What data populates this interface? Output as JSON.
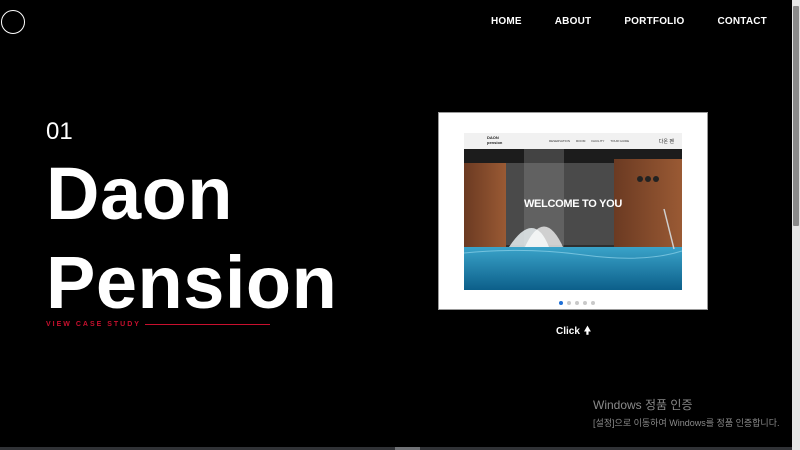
{
  "nav": {
    "items": [
      {
        "label": "HOME"
      },
      {
        "label": "ABOUT"
      },
      {
        "label": "PORTFOLIO"
      },
      {
        "label": "CONTACT"
      }
    ]
  },
  "hero": {
    "index": "01",
    "title_line1": "Daon",
    "title_line2": "Pension",
    "case_study": "VIEW CASE STUDY",
    "accent_color": "#c8102e"
  },
  "preview": {
    "site_brand_line1": "DAON",
    "site_brand_line2": "pension",
    "site_menu": [
      "RESERVATION",
      "ROOM",
      "FACILITY",
      "TOUR GUIDE"
    ],
    "site_korean_mark": "다온 펜",
    "headline": "WELCOME TO YOU",
    "slide_count": 5,
    "active_slide": 1
  },
  "click": {
    "label": "Click",
    "icon": "arrow-up-icon"
  },
  "watermark": {
    "line1": "Windows 정품 인증",
    "line2": "[설정]으로 이동하여 Windows를 정품 인증합니다."
  }
}
